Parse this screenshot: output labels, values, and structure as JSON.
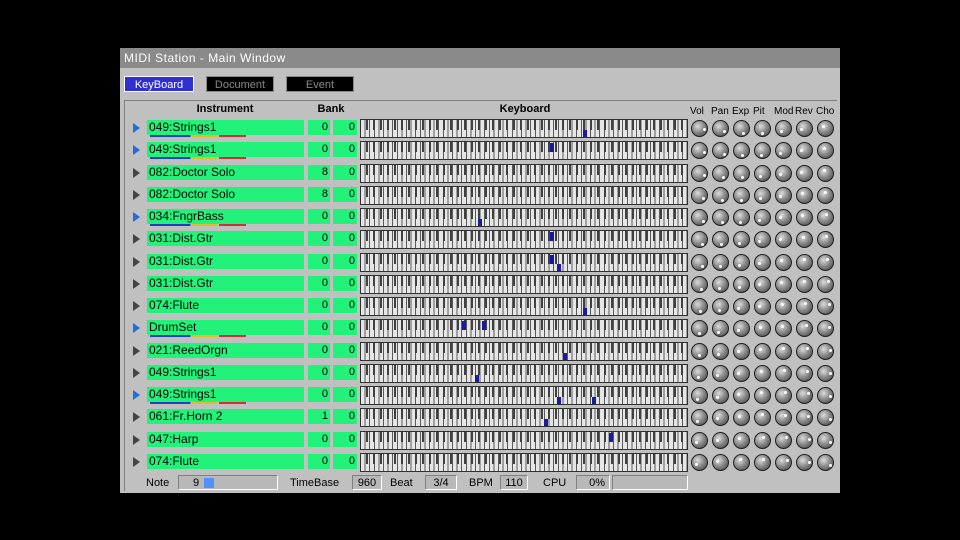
{
  "window": {
    "title": "MIDI Station - Main Window"
  },
  "tabs": [
    "KeyBoard",
    "Document",
    "Event"
  ],
  "headers": {
    "instrument": "Instrument",
    "bank": "Bank",
    "keyboard": "Keyboard"
  },
  "knob_headers": [
    "Vol",
    "Pan",
    "Exp",
    "Pit",
    "Mod",
    "Rev",
    "Cho"
  ],
  "tracks": [
    {
      "name": "049:Strings1",
      "bank1": "0",
      "bank2": "0",
      "active": true,
      "notes": [
        0.68
      ]
    },
    {
      "name": "049:Strings1",
      "bank1": "0",
      "bank2": "0",
      "active": true,
      "notes": [
        0.58
      ]
    },
    {
      "name": "082:Doctor Solo",
      "bank1": "8",
      "bank2": "0",
      "active": false,
      "notes": []
    },
    {
      "name": "082:Doctor Solo",
      "bank1": "8",
      "bank2": "0",
      "active": false,
      "notes": []
    },
    {
      "name": "034:FngrBass",
      "bank1": "0",
      "bank2": "0",
      "active": true,
      "notes": [
        0.36
      ]
    },
    {
      "name": "031:Dist.Gtr",
      "bank1": "0",
      "bank2": "0",
      "active": false,
      "notes": [
        0.58
      ]
    },
    {
      "name": "031:Dist.Gtr",
      "bank1": "0",
      "bank2": "0",
      "active": false,
      "notes": [
        0.58,
        0.6
      ]
    },
    {
      "name": "031:Dist.Gtr",
      "bank1": "0",
      "bank2": "0",
      "active": false,
      "notes": []
    },
    {
      "name": "074:Flute",
      "bank1": "0",
      "bank2": "0",
      "active": false,
      "notes": [
        0.68
      ]
    },
    {
      "name": "DrumSet",
      "bank1": "0",
      "bank2": "0",
      "active": true,
      "notes": [
        0.31,
        0.37
      ]
    },
    {
      "name": "021:ReedOrgn",
      "bank1": "0",
      "bank2": "0",
      "active": false,
      "notes": [
        0.62
      ]
    },
    {
      "name": "049:Strings1",
      "bank1": "0",
      "bank2": "0",
      "active": false,
      "notes": [
        0.35
      ]
    },
    {
      "name": "049:Strings1",
      "bank1": "0",
      "bank2": "0",
      "active": true,
      "notes": [
        0.6,
        0.71
      ]
    },
    {
      "name": "061:Fr.Horn 2",
      "bank1": "1",
      "bank2": "0",
      "active": false,
      "notes": [
        0.56
      ]
    },
    {
      "name": "047:Harp",
      "bank1": "0",
      "bank2": "0",
      "active": false,
      "notes": [
        0.76
      ]
    },
    {
      "name": "074:Flute",
      "bank1": "0",
      "bank2": "0",
      "active": false,
      "notes": []
    }
  ],
  "status": {
    "note_label": "Note",
    "note_value": "9",
    "timebase_label": "TimeBase",
    "timebase_value": "960",
    "beat_label": "Beat",
    "beat_value": "3/4",
    "bpm_label": "BPM",
    "bpm_value": "110",
    "cpu_label": "CPU",
    "cpu_value": "0%"
  }
}
